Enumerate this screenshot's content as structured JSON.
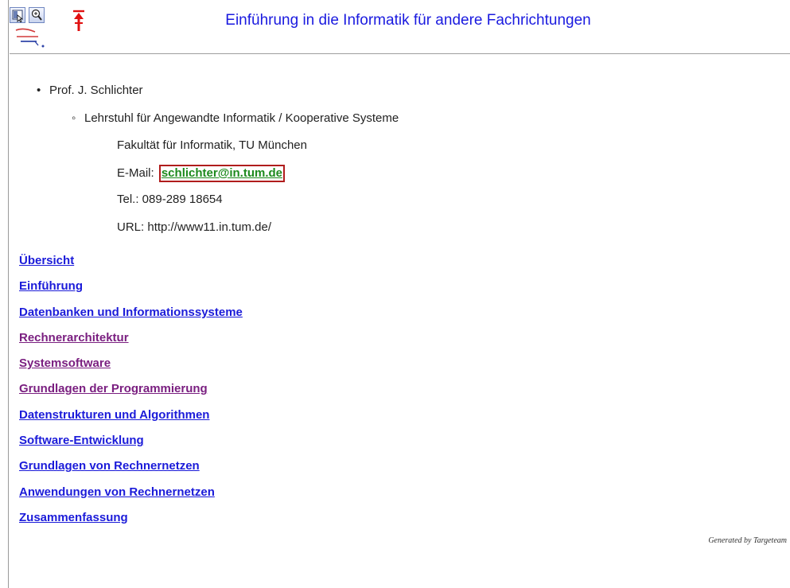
{
  "header": {
    "title": "Einführung in die Informatik für andere Fachrichtungen",
    "icons": [
      "view-toggle-icon",
      "zoom-icon",
      "up-arrow-icon",
      "decorative-lines-icon"
    ]
  },
  "contact": {
    "name": "Prof. J. Schlichter",
    "chair": "Lehrstuhl für Angewandte Informatik / Kooperative Systeme",
    "faculty": "Fakultät für Informatik, TU München",
    "email_label": "E-Mail:",
    "email": "schlichter@in.tum.de",
    "tel": "Tel.: 089-289 18654",
    "url_label": "URL:",
    "url": "http://www11.in.tum.de/"
  },
  "nav": {
    "links": [
      {
        "label": "Übersicht",
        "visited": false
      },
      {
        "label": "Einführung",
        "visited": false
      },
      {
        "label": "Datenbanken und Informationssysteme",
        "visited": false
      },
      {
        "label": "Rechnerarchitektur",
        "visited": true
      },
      {
        "label": "Systemsoftware",
        "visited": true
      },
      {
        "label": "Grundlagen der Programmierung",
        "visited": true
      },
      {
        "label": "Datenstrukturen und Algorithmen",
        "visited": false
      },
      {
        "label": "Software-Entwicklung",
        "visited": false
      },
      {
        "label": "Grundlagen von Rechnernetzen",
        "visited": false
      },
      {
        "label": "Anwendungen von Rechnernetzen",
        "visited": false
      },
      {
        "label": "Zusammenfassung",
        "visited": false
      }
    ]
  },
  "footer": {
    "text": "Generated by Targeteam"
  },
  "colors": {
    "title": "#1a1adf",
    "link": "#1b1bd9",
    "visited": "#7a1f80",
    "email": "#1d8a1d",
    "email_border": "#b01c1c"
  }
}
